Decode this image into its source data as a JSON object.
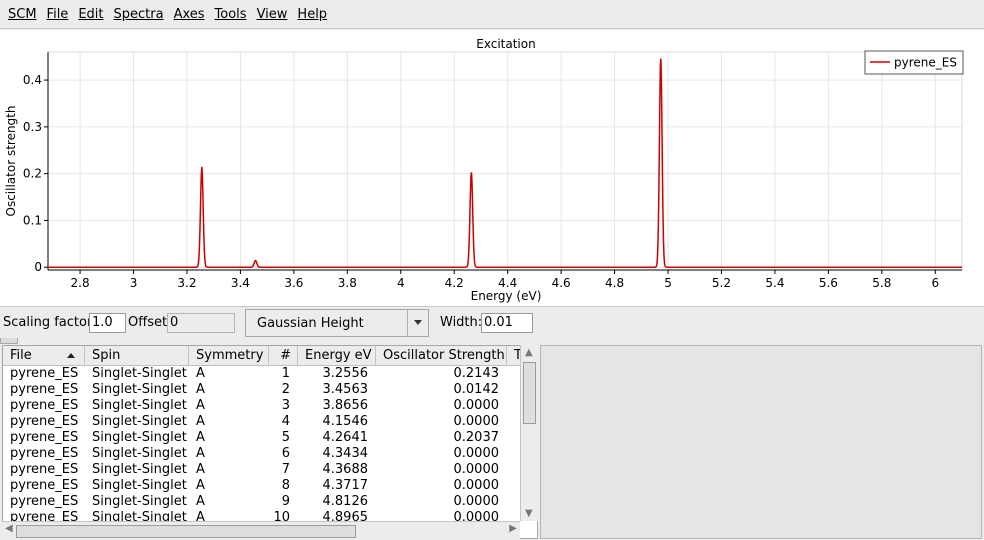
{
  "menu": [
    "SCM",
    "File",
    "Edit",
    "Spectra",
    "Axes",
    "Tools",
    "View",
    "Help"
  ],
  "colors": {
    "spectrum": "#cc0000",
    "grid": "#e6e6e6"
  },
  "chart_data": {
    "type": "line",
    "title": "Excitation",
    "xlabel": "Energy (eV)",
    "ylabel": "Oscillator strength",
    "xlim": [
      2.68,
      6.1
    ],
    "ylim": [
      -0.006,
      0.46
    ],
    "xticks": [
      2.8,
      3,
      3.2,
      3.4,
      3.6,
      3.8,
      4,
      4.2,
      4.4,
      4.6,
      4.8,
      5,
      5.2,
      5.4,
      5.6,
      5.8,
      6
    ],
    "xtick_labels": [
      "2.8",
      "3",
      "3.2",
      "3.4",
      "3.6",
      "3.8",
      "4",
      "4.2",
      "4.4",
      "4.6",
      "4.8",
      "5",
      "5.2",
      "5.4",
      "5.6",
      "5.8",
      "6"
    ],
    "yticks": [
      0,
      0.1,
      0.2,
      0.3,
      0.4
    ],
    "ytick_labels": [
      "0",
      "0.1",
      "0.2",
      "0.3",
      "0.4"
    ],
    "grid": true,
    "legend_position": "top-right",
    "series": [
      {
        "name": "pyrene_ES",
        "broadening": "gaussian",
        "width": 0.01,
        "peaks": [
          {
            "x": 3.2556,
            "y": 0.2143
          },
          {
            "x": 3.4563,
            "y": 0.0142
          },
          {
            "x": 4.2641,
            "y": 0.2037
          },
          {
            "x": 4.9728,
            "y": 0.448
          }
        ]
      }
    ]
  },
  "controls": {
    "scaling_label": "Scaling factor:",
    "scaling_value": "1.0",
    "offset_label": "Offset:",
    "offset_value": "0",
    "broadening_mode": "Gaussian Height",
    "width_label": "Width:",
    "width_value": "0.01"
  },
  "table": {
    "columns": [
      "File",
      "Spin",
      "Symmetry",
      "#",
      "Energy eV",
      "Oscillator Strength",
      "T"
    ],
    "rows": [
      [
        "pyrene_ES",
        "Singlet-Singlet",
        "A",
        "1",
        "3.2556",
        "0.2143"
      ],
      [
        "pyrene_ES",
        "Singlet-Singlet",
        "A",
        "2",
        "3.4563",
        "0.0142"
      ],
      [
        "pyrene_ES",
        "Singlet-Singlet",
        "A",
        "3",
        "3.8656",
        "0.0000"
      ],
      [
        "pyrene_ES",
        "Singlet-Singlet",
        "A",
        "4",
        "4.1546",
        "0.0000"
      ],
      [
        "pyrene_ES",
        "Singlet-Singlet",
        "A",
        "5",
        "4.2641",
        "0.2037"
      ],
      [
        "pyrene_ES",
        "Singlet-Singlet",
        "A",
        "6",
        "4.3434",
        "0.0000"
      ],
      [
        "pyrene_ES",
        "Singlet-Singlet",
        "A",
        "7",
        "4.3688",
        "0.0000"
      ],
      [
        "pyrene_ES",
        "Singlet-Singlet",
        "A",
        "8",
        "4.3717",
        "0.0000"
      ],
      [
        "pyrene_ES",
        "Singlet-Singlet",
        "A",
        "9",
        "4.8126",
        "0.0000"
      ],
      [
        "pyrene_ES",
        "Singlet-Singlet",
        "A",
        "10",
        "4.8965",
        "0.0000"
      ]
    ]
  }
}
